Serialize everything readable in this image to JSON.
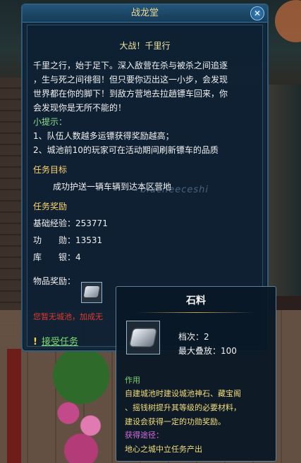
{
  "window": {
    "title": "战龙堂",
    "close_icon": "close-icon"
  },
  "quest": {
    "heading": "大战！千里行",
    "description_lines": [
      "千里之行，始于足下。深入敌营在杀与被杀之间追逐",
      "，生与死之间徘徊！但只要你迈出这一小步，会发现",
      "世界都在你的脚下！到敌方营地去拉趟镖车回来，你",
      "会发现你是无所不能的！"
    ],
    "tips_label": "小提示：",
    "tips": [
      "1、队伍人数越多运镖获得奖励越高；",
      "2、城池前10的玩家可在活动期间刷新镖车的品质"
    ],
    "goal_label": "任务目标",
    "goal_text": "成功护送一辆车辆到达本区营地",
    "reward_label": "任务奖励",
    "rewards": {
      "exp_label": "基础经验：",
      "exp_value": "253771",
      "merit_label": "功　　勋：",
      "merit_value": "13531",
      "silver_label": "库　　银：",
      "silver_value": "4",
      "item_label": "物品奖励："
    },
    "warning": "您暂无城池，加成无",
    "accept_label": "接受任务",
    "watermark": "blacheeceshi"
  },
  "tooltip": {
    "title": "石料",
    "grade_label": "档次：",
    "grade_value": "2",
    "stack_label": "最大叠放：",
    "stack_value": "100",
    "usage_label": "作用",
    "usage_lines": [
      "自建城池时建设城池神石、藏宝阁",
      "、摇钱树提升其等级的必要材料，",
      "建设会获得一定的功勋奖励。"
    ],
    "source_label": "获得途径：",
    "source_text": "地心之城中立任务产出"
  },
  "colors": {
    "accent_gold": "#ffd66e",
    "accent_green": "#7fdc6e",
    "warning_red": "#e03a2e",
    "purple": "#d36de0"
  }
}
